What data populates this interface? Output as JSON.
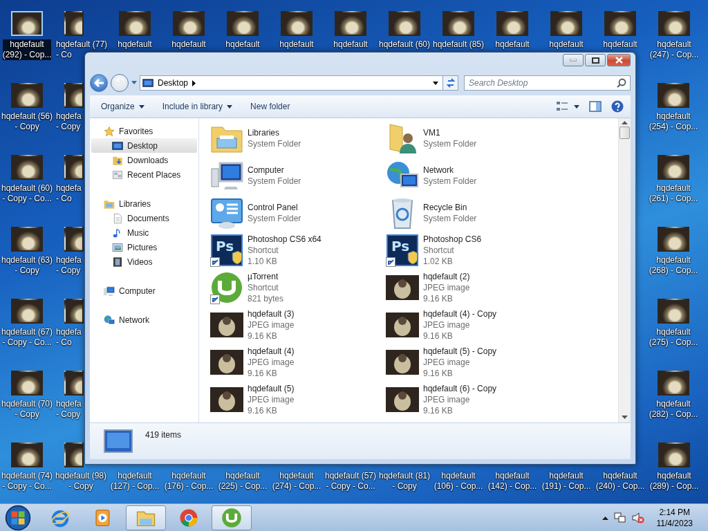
{
  "desktop": {
    "top_row": [
      {
        "lines": [
          "hqdefault",
          "(292) - Cop..."
        ],
        "selected": true
      },
      {
        "lines": [
          "hqdefault (77)",
          "- Co"
        ],
        "selected": false
      },
      {
        "lines": [
          "hqdefault"
        ],
        "selected": false
      },
      {
        "lines": [
          "hqdefault"
        ],
        "selected": false
      },
      {
        "lines": [
          "hqdefault"
        ],
        "selected": false
      },
      {
        "lines": [
          "hqdefault"
        ],
        "selected": false
      },
      {
        "lines": [
          "hqdefault"
        ],
        "selected": false
      },
      {
        "lines": [
          "hqdefault (60)"
        ],
        "selected": false
      },
      {
        "lines": [
          "hqdefault (85)"
        ],
        "selected": false
      },
      {
        "lines": [
          "hqdefault"
        ],
        "selected": false
      },
      {
        "lines": [
          "hqdefault"
        ],
        "selected": false
      },
      {
        "lines": [
          "hqdefault"
        ],
        "selected": false
      },
      {
        "lines": [
          "hqdefault",
          "(247) - Cop..."
        ],
        "selected": false
      }
    ],
    "left_rows": [
      {
        "icons": [
          {
            "lines": [
              "hqdefault (56)",
              "- Copy"
            ],
            "selected": false
          },
          {
            "lines": [
              "hqdefa",
              "- Copy"
            ],
            "selected": false
          }
        ]
      },
      {
        "icons": [
          {
            "lines": [
              "hqdefault (60)",
              "- Copy - Co..."
            ],
            "selected": false
          },
          {
            "lines": [
              "hqdefa",
              "- Co"
            ],
            "selected": false
          }
        ]
      },
      {
        "icons": [
          {
            "lines": [
              "hqdefault (63)",
              "- Copy"
            ],
            "selected": false
          },
          {
            "lines": [
              "hqdefa",
              "- Copy"
            ],
            "selected": false
          }
        ]
      },
      {
        "icons": [
          {
            "lines": [
              "hqdefault (67)",
              "- Copy - Co..."
            ],
            "selected": false
          },
          {
            "lines": [
              "hqdefa",
              "- Co"
            ],
            "selected": false
          }
        ]
      },
      {
        "icons": [
          {
            "lines": [
              "hqdefault (70)",
              "- Copy"
            ],
            "selected": false
          },
          {
            "lines": [
              "hqdefa",
              "- Copy"
            ],
            "selected": false
          }
        ]
      }
    ],
    "right_column": [
      {
        "lines": [
          "hqdefault",
          "(254) - Cop..."
        ],
        "selected": false
      },
      {
        "lines": [
          "hqdefault",
          "(261) - Cop..."
        ],
        "selected": false
      },
      {
        "lines": [
          "hqdefault",
          "(268) - Cop..."
        ],
        "selected": false
      },
      {
        "lines": [
          "hqdefault",
          "(275) - Cop..."
        ],
        "selected": false
      },
      {
        "lines": [
          "hqdefault",
          "(282) - Cop..."
        ],
        "selected": false
      }
    ],
    "bottom_row": [
      {
        "lines": [
          "hqdefault (74)",
          "- Copy - Co..."
        ],
        "selected": false
      },
      {
        "lines": [
          "hqdefault (98)",
          "- Copy"
        ],
        "selected": false
      },
      {
        "lines": [
          "hqdefault",
          "(127) - Cop..."
        ],
        "selected": false
      },
      {
        "lines": [
          "hqdefault",
          "(176) - Cop..."
        ],
        "selected": false
      },
      {
        "lines": [
          "hqdefault",
          "(225) - Cop..."
        ],
        "selected": false
      },
      {
        "lines": [
          "hqdefault",
          "(274) - Cop..."
        ],
        "selected": false
      },
      {
        "lines": [
          "hqdefault (57)",
          "- Copy - Co..."
        ],
        "selected": false
      },
      {
        "lines": [
          "hqdefault (81)",
          "- Copy"
        ],
        "selected": false
      },
      {
        "lines": [
          "hqdefault",
          "(106) - Cop..."
        ],
        "selected": false
      },
      {
        "lines": [
          "hqdefault",
          "(142) - Cop..."
        ],
        "selected": false
      },
      {
        "lines": [
          "hqdefault",
          "(191) - Cop..."
        ],
        "selected": false
      },
      {
        "lines": [
          "hqdefault",
          "(240) - Cop..."
        ],
        "selected": false
      },
      {
        "lines": [
          "hqdefault",
          "(289) - Cop..."
        ],
        "selected": false
      }
    ]
  },
  "window": {
    "address": "Desktop",
    "search": {
      "placeholder": "Search Desktop"
    },
    "toolbar": [
      "Organize",
      "Include in library",
      "New folder"
    ],
    "nav_pane": [
      {
        "label": "Favorites",
        "kind": "star",
        "selected": false,
        "children": [
          {
            "label": "Desktop",
            "kind": "desktop",
            "selected": true
          },
          {
            "label": "Downloads",
            "kind": "downloads",
            "selected": false
          },
          {
            "label": "Recent Places",
            "kind": "recent",
            "selected": false
          }
        ]
      },
      {
        "label": "Libraries",
        "kind": "library",
        "selected": false,
        "children": [
          {
            "label": "Documents",
            "kind": "document",
            "selected": false
          },
          {
            "label": "Music",
            "kind": "music",
            "selected": false
          },
          {
            "label": "Pictures",
            "kind": "pictures",
            "selected": false
          },
          {
            "label": "Videos",
            "kind": "video",
            "selected": false
          }
        ]
      },
      {
        "label": "Computer",
        "kind": "computer",
        "selected": false
      },
      {
        "label": "Network",
        "kind": "network",
        "selected": false
      }
    ],
    "items": [
      {
        "name": "Libraries",
        "type": "System Folder",
        "kind": "libraries-folder",
        "shortcut": false
      },
      {
        "name": "VM1",
        "type": "System Folder",
        "kind": "user-folder",
        "shortcut": false
      },
      {
        "name": "Computer",
        "type": "System Folder",
        "kind": "computer",
        "shortcut": false
      },
      {
        "name": "Network",
        "type": "System Folder",
        "kind": "network",
        "shortcut": false
      },
      {
        "name": "Control Panel",
        "type": "System Folder",
        "kind": "control-panel",
        "shortcut": false
      },
      {
        "name": "Recycle Bin",
        "type": "System Folder",
        "kind": "recycle-bin",
        "shortcut": false
      },
      {
        "name": "Photoshop CS6 x64",
        "type": "Shortcut",
        "size": "1.10 KB",
        "kind": "photoshop",
        "icon_text": "Ps",
        "shortcut": true
      },
      {
        "name": "Photoshop CS6",
        "type": "Shortcut",
        "size": "1.02 KB",
        "kind": "photoshop",
        "icon_text": "Ps",
        "shortcut": true
      },
      {
        "name": "µTorrent",
        "type": "Shortcut",
        "size": "821 bytes",
        "kind": "utorrent",
        "shortcut": true
      },
      {
        "name": "hqdefault (2)",
        "type": "JPEG image",
        "size": "9.16 KB",
        "kind": "image",
        "shortcut": false
      },
      {
        "name": "hqdefault (3)",
        "type": "JPEG image",
        "size": "9.16 KB",
        "kind": "image",
        "shortcut": false
      },
      {
        "name": "hqdefault (4) - Copy",
        "type": "JPEG image",
        "size": "9.16 KB",
        "kind": "image",
        "shortcut": false
      },
      {
        "name": "hqdefault (4)",
        "type": "JPEG image",
        "size": "9.16 KB",
        "kind": "image",
        "shortcut": false
      },
      {
        "name": "hqdefault (5) - Copy",
        "type": "JPEG image",
        "size": "9.16 KB",
        "kind": "image",
        "shortcut": false
      },
      {
        "name": "hqdefault (5)",
        "type": "JPEG image",
        "size": "9.16 KB",
        "kind": "image",
        "shortcut": false
      },
      {
        "name": "hqdefault (6) - Copy",
        "type": "JPEG image",
        "size": "9.16 KB",
        "kind": "image",
        "shortcut": false
      }
    ],
    "status": "419 items"
  },
  "taskbar": {
    "items": [
      {
        "kind": "ie",
        "active": false
      },
      {
        "kind": "media",
        "active": false
      },
      {
        "kind": "explorer",
        "active": true
      },
      {
        "kind": "chrome",
        "active": false
      },
      {
        "kind": "utorrent",
        "active": true
      }
    ],
    "time": "2:14 PM",
    "date": "11/4/2023"
  }
}
